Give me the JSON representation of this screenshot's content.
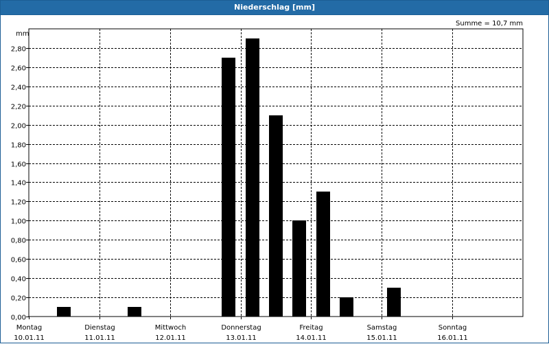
{
  "window": {
    "title": "Niederschlag [mm]"
  },
  "chart_data": {
    "type": "bar",
    "title": "Niederschlag [mm]",
    "unit_label": "mm",
    "sum_label": "Summe = 10,7 mm",
    "xlabel": "",
    "ylabel": "mm",
    "ylim": [
      0,
      3.0
    ],
    "yticks": [
      "0,00",
      "0,20",
      "0,40",
      "0,60",
      "0,80",
      "1,00",
      "1,20",
      "1,40",
      "1,60",
      "1,80",
      "2,00",
      "2,20",
      "2,40",
      "2,60",
      "2,80"
    ],
    "x_range_days": [
      0,
      7
    ],
    "days": [
      {
        "name": "Montag",
        "date": "10.01.11"
      },
      {
        "name": "Dienstag",
        "date": "11.01.11"
      },
      {
        "name": "Mittwoch",
        "date": "12.01.11"
      },
      {
        "name": "Donnerstag",
        "date": "13.01.11"
      },
      {
        "name": "Freitag",
        "date": "14.01.11"
      },
      {
        "name": "Samstag",
        "date": "15.01.11"
      },
      {
        "name": "Sonntag",
        "date": "16.01.11"
      }
    ],
    "bars": [
      {
        "day": 0.5,
        "value": 0.1
      },
      {
        "day": 1.5,
        "value": 0.1
      },
      {
        "day": 2.83,
        "value": 2.7
      },
      {
        "day": 3.17,
        "value": 2.9
      },
      {
        "day": 3.5,
        "value": 2.1
      },
      {
        "day": 3.83,
        "value": 1.0
      },
      {
        "day": 4.17,
        "value": 1.3
      },
      {
        "day": 4.5,
        "value": 0.2
      },
      {
        "day": 5.17,
        "value": 0.3
      }
    ],
    "grid": true,
    "bar_color": "#000000"
  }
}
